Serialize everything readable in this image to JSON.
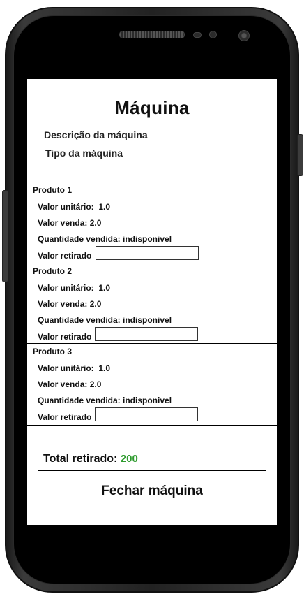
{
  "screen": {
    "title": "Máquina",
    "description_label": "Descrição da máquina",
    "type_label": "Tipo da máquina",
    "products": [
      {
        "name": "Produto 1",
        "unit_value": "Valor unitário:  1.0",
        "sale_value": "Valor venda: 2.0",
        "quantity_sold": "Quantidade vendida: indisponivel",
        "withdrawn_label": "Valor retirado",
        "withdrawn_value": ""
      },
      {
        "name": "Produto 2",
        "unit_value": "Valor unitário:  1.0",
        "sale_value": "Valor venda: 2.0",
        "quantity_sold": "Quantidade vendida: indisponivel",
        "withdrawn_label": "Valor retirado",
        "withdrawn_value": ""
      },
      {
        "name": "Produto 3",
        "unit_value": "Valor unitário:  1.0",
        "sale_value": "Valor venda: 2.0",
        "quantity_sold": "Quantidade vendida: indisponivel",
        "withdrawn_label": "Valor retirado",
        "withdrawn_value": ""
      }
    ],
    "total_label": "Total retirado:",
    "total_value": "200",
    "close_button": "Fechar máquina"
  },
  "colors": {
    "total_value": "#2e9b2e",
    "phone_body": "#222222",
    "screen_bg": "#ffffff"
  }
}
